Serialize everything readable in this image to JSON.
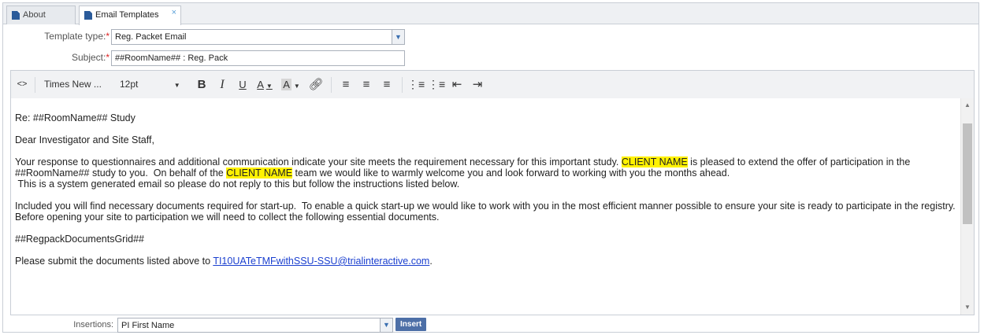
{
  "tabs": [
    {
      "label": "About",
      "active": false
    },
    {
      "label": "Email Templates",
      "active": true,
      "close": "×"
    }
  ],
  "form": {
    "template_type_label": "Template type:",
    "template_type_value": "Reg. Packet Email",
    "subject_label": "Subject:",
    "subject_value": "##RoomName## : Reg. Pack",
    "required_mark": "*"
  },
  "toolbar": {
    "source_code": "<>",
    "font_family": "Times New ...",
    "font_size": "12pt",
    "bold": "B",
    "italic": "I",
    "underline": "U",
    "text_color": "A",
    "bg_color": "A",
    "icons": [
      "source-code-icon",
      "bold-icon",
      "italic-icon",
      "underline-icon",
      "text-color-icon",
      "background-color-icon",
      "link-icon",
      "align-left-icon",
      "align-center-icon",
      "align-right-icon",
      "bullet-list-icon",
      "numbered-list-icon",
      "outdent-icon",
      "indent-icon"
    ]
  },
  "body": {
    "line1": "Re: ##RoomName## Study",
    "line2": "Dear Investigator and Site Staff,",
    "p3_a": "Your response to questionnaires and additional communication indicate your site meets the requirement necessary for this important study. ",
    "p3_client1": "CLIENT NAME",
    "p3_b": " is pleased to extend the offer of participation in the ##RoomName## study to you.  On behalf of the ",
    "p3_client2": "CLIENT NAME",
    "p3_c": " team we would like to warmly welcome you and look forward to working with you the months ahead.\n This is a system generated email so please do not reply to this but follow the instructions listed below.",
    "p4": "Included you will find necessary documents required for start-up.  To enable a quick start-up we would like to work with you in the most efficient manner possible to ensure your site is ready to participate in the registry. Before opening your site to participation we will need to collect the following essential documents.",
    "p5": "##RegpackDocumentsGrid##",
    "p6_a": "Please submit the documents listed above to ",
    "p6_link": "TI10UATeTMFwithSSU-SSU@trialinteractive.com",
    "p6_b": "."
  },
  "insertions": {
    "label": "Insertions:",
    "value": "PI First Name",
    "button": "Insert"
  },
  "colors": {
    "highlight": "#fff200",
    "link": "#1a3fcf",
    "accent": "#4d6fa7"
  }
}
